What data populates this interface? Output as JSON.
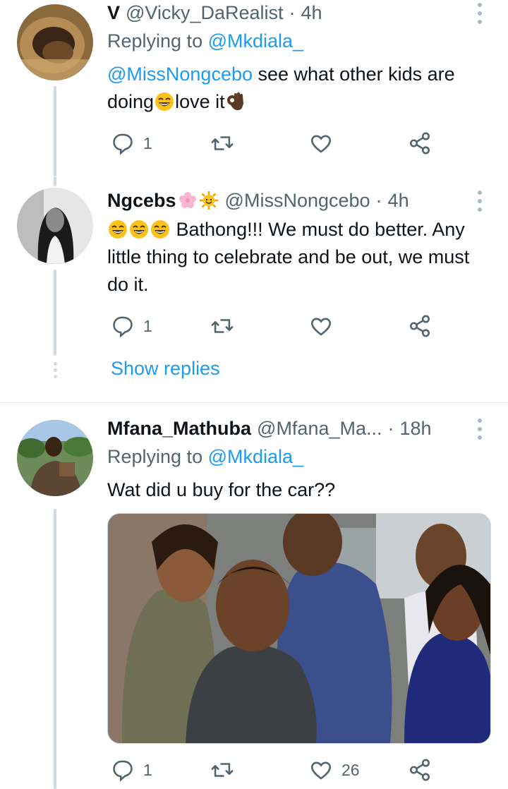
{
  "tweets": [
    {
      "name": "V",
      "handle": "@Vicky_DaRealist",
      "dot": "·",
      "time": "4h",
      "replying_label": "Replying to",
      "replying_handle": "@Mkdiala_",
      "text_mention": "@MissNongcebo",
      "text_part1": " see what other kids are doing",
      "text_part2": "love it",
      "emojis": [
        "grinning-sweat-emoji",
        "ok-hand-emoji"
      ],
      "reply_count": "1",
      "retweet_count": "",
      "like_count": ""
    },
    {
      "name": "Ngcebs",
      "name_emojis": [
        "cherry-blossom-emoji",
        "sun-emoji"
      ],
      "handle": "@MissNongcebo",
      "dot": "·",
      "time": "4h",
      "text": " Bathong!!! We must do better. Any little thing to celebrate and be out, we must do it.",
      "reply_count": "1",
      "retweet_count": "",
      "like_count": ""
    },
    {
      "name": "Mfana_Mathuba",
      "handle": "@Mfana_Ma...",
      "dot": "·",
      "time": "18h",
      "replying_label": "Replying to",
      "replying_handle": "@Mkdiala_",
      "text": "Wat did u buy for the car??",
      "reply_count": "1",
      "retweet_count": "",
      "like_count": "26"
    }
  ],
  "show_replies": "Show replies",
  "colors": {
    "accent": "#1d9bf0",
    "secondary_text": "#536471",
    "thread_line": "#cfd9de"
  }
}
